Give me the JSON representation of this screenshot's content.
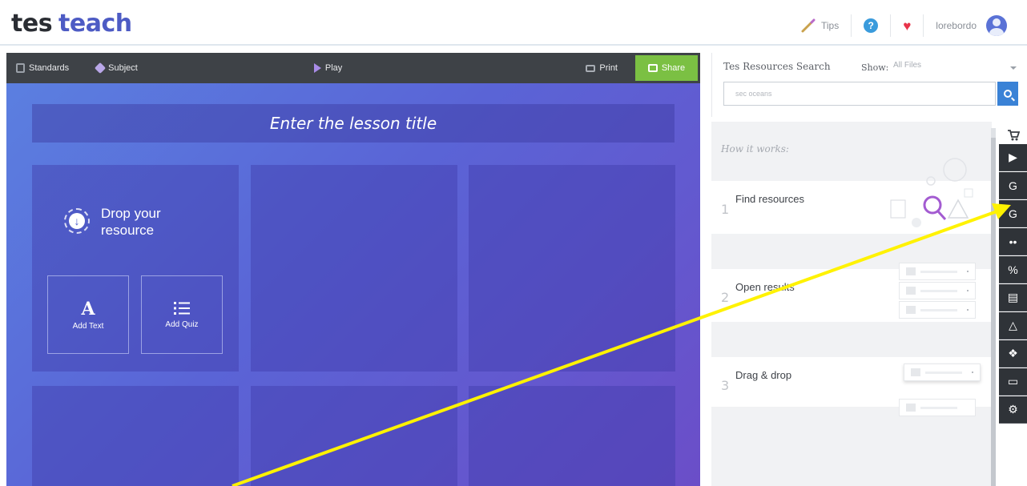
{
  "header": {
    "logo_part1": "tes",
    "logo_part2": "teach",
    "tips_label": "Tips",
    "help_glyph": "?",
    "username": "lorebordo",
    "colors": {
      "brand_blue": "#4d5bc4",
      "heart": "#e8344a",
      "help": "#3a9bdc"
    }
  },
  "toolbar": {
    "standards_label": "Standards",
    "subject_label": "Subject",
    "play_label": "Play",
    "print_label": "Print",
    "share_label": "Share",
    "colors": {
      "bar": "#3e4247",
      "share": "#7bc043"
    }
  },
  "canvas": {
    "lesson_title_placeholder": "Enter the lesson title",
    "drop_label": "Drop your resource",
    "add_text_label": "Add Text",
    "add_text_glyph": "A",
    "add_quiz_label": "Add Quiz",
    "gradient_colors": [
      "#5b7fe0",
      "#5a64d6",
      "#6b4ec8"
    ]
  },
  "right_panel": {
    "search_title": "Tes Resources Search",
    "show_label": "Show:",
    "show_value": "All Files",
    "search_value": "sec oceans",
    "how_it_works": "How it works:",
    "steps": [
      {
        "num": "1",
        "label": "Find resources"
      },
      {
        "num": "2",
        "label": "Open results"
      },
      {
        "num": "3",
        "label": "Drag & drop"
      }
    ],
    "rail_icons": [
      "cart-icon",
      "youtube-icon",
      "google-icon",
      "google-plus-icon",
      "flickr-icon",
      "link-icon",
      "printer-icon",
      "google-drive-icon",
      "dropbox-icon",
      "computer-icon",
      "settings-icon"
    ]
  },
  "overlay": {
    "arrow_color": "#fff200"
  }
}
